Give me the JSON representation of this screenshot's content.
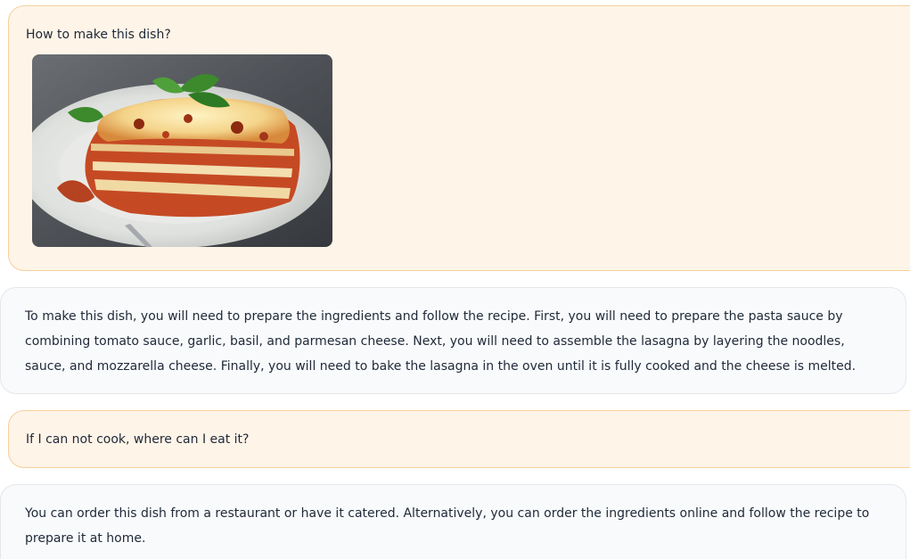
{
  "messages": [
    {
      "role": "user",
      "text": "How to make this dish?",
      "image": "lasagna-photo"
    },
    {
      "role": "assistant",
      "text": "To make this dish, you will need to prepare the ingredients and follow the recipe. First, you will need to prepare the pasta sauce by combining tomato sauce, garlic, basil, and parmesan cheese. Next, you will need to assemble the lasagna by layering the noodles, sauce, and mozzarella cheese. Finally, you will need to bake the lasagna in the oven until it is fully cooked and the cheese is melted."
    },
    {
      "role": "user",
      "text": "If I can not cook, where can I eat it?"
    },
    {
      "role": "assistant",
      "text": "You can order this dish from a restaurant or have it catered. Alternatively, you can order the ingredients online and follow the recipe to prepare it at home."
    }
  ],
  "colors": {
    "user_bubble": "#fff4e8",
    "user_border": "#f6cf9c",
    "assistant_bubble": "#f8fafc",
    "assistant_border": "#e5e7eb"
  }
}
